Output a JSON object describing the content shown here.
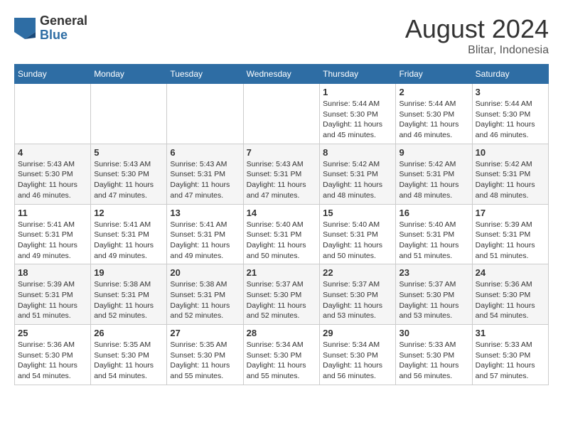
{
  "header": {
    "logo_general": "General",
    "logo_blue": "Blue",
    "title": "August 2024",
    "location": "Blitar, Indonesia"
  },
  "weekdays": [
    "Sunday",
    "Monday",
    "Tuesday",
    "Wednesday",
    "Thursday",
    "Friday",
    "Saturday"
  ],
  "weeks": [
    [
      {
        "day": "",
        "info": ""
      },
      {
        "day": "",
        "info": ""
      },
      {
        "day": "",
        "info": ""
      },
      {
        "day": "",
        "info": ""
      },
      {
        "day": "1",
        "info": "Sunrise: 5:44 AM\nSunset: 5:30 PM\nDaylight: 11 hours\nand 45 minutes."
      },
      {
        "day": "2",
        "info": "Sunrise: 5:44 AM\nSunset: 5:30 PM\nDaylight: 11 hours\nand 46 minutes."
      },
      {
        "day": "3",
        "info": "Sunrise: 5:44 AM\nSunset: 5:30 PM\nDaylight: 11 hours\nand 46 minutes."
      }
    ],
    [
      {
        "day": "4",
        "info": "Sunrise: 5:43 AM\nSunset: 5:30 PM\nDaylight: 11 hours\nand 46 minutes."
      },
      {
        "day": "5",
        "info": "Sunrise: 5:43 AM\nSunset: 5:30 PM\nDaylight: 11 hours\nand 47 minutes."
      },
      {
        "day": "6",
        "info": "Sunrise: 5:43 AM\nSunset: 5:31 PM\nDaylight: 11 hours\nand 47 minutes."
      },
      {
        "day": "7",
        "info": "Sunrise: 5:43 AM\nSunset: 5:31 PM\nDaylight: 11 hours\nand 47 minutes."
      },
      {
        "day": "8",
        "info": "Sunrise: 5:42 AM\nSunset: 5:31 PM\nDaylight: 11 hours\nand 48 minutes."
      },
      {
        "day": "9",
        "info": "Sunrise: 5:42 AM\nSunset: 5:31 PM\nDaylight: 11 hours\nand 48 minutes."
      },
      {
        "day": "10",
        "info": "Sunrise: 5:42 AM\nSunset: 5:31 PM\nDaylight: 11 hours\nand 48 minutes."
      }
    ],
    [
      {
        "day": "11",
        "info": "Sunrise: 5:41 AM\nSunset: 5:31 PM\nDaylight: 11 hours\nand 49 minutes."
      },
      {
        "day": "12",
        "info": "Sunrise: 5:41 AM\nSunset: 5:31 PM\nDaylight: 11 hours\nand 49 minutes."
      },
      {
        "day": "13",
        "info": "Sunrise: 5:41 AM\nSunset: 5:31 PM\nDaylight: 11 hours\nand 49 minutes."
      },
      {
        "day": "14",
        "info": "Sunrise: 5:40 AM\nSunset: 5:31 PM\nDaylight: 11 hours\nand 50 minutes."
      },
      {
        "day": "15",
        "info": "Sunrise: 5:40 AM\nSunset: 5:31 PM\nDaylight: 11 hours\nand 50 minutes."
      },
      {
        "day": "16",
        "info": "Sunrise: 5:40 AM\nSunset: 5:31 PM\nDaylight: 11 hours\nand 51 minutes."
      },
      {
        "day": "17",
        "info": "Sunrise: 5:39 AM\nSunset: 5:31 PM\nDaylight: 11 hours\nand 51 minutes."
      }
    ],
    [
      {
        "day": "18",
        "info": "Sunrise: 5:39 AM\nSunset: 5:31 PM\nDaylight: 11 hours\nand 51 minutes."
      },
      {
        "day": "19",
        "info": "Sunrise: 5:38 AM\nSunset: 5:31 PM\nDaylight: 11 hours\nand 52 minutes."
      },
      {
        "day": "20",
        "info": "Sunrise: 5:38 AM\nSunset: 5:31 PM\nDaylight: 11 hours\nand 52 minutes."
      },
      {
        "day": "21",
        "info": "Sunrise: 5:37 AM\nSunset: 5:30 PM\nDaylight: 11 hours\nand 52 minutes."
      },
      {
        "day": "22",
        "info": "Sunrise: 5:37 AM\nSunset: 5:30 PM\nDaylight: 11 hours\nand 53 minutes."
      },
      {
        "day": "23",
        "info": "Sunrise: 5:37 AM\nSunset: 5:30 PM\nDaylight: 11 hours\nand 53 minutes."
      },
      {
        "day": "24",
        "info": "Sunrise: 5:36 AM\nSunset: 5:30 PM\nDaylight: 11 hours\nand 54 minutes."
      }
    ],
    [
      {
        "day": "25",
        "info": "Sunrise: 5:36 AM\nSunset: 5:30 PM\nDaylight: 11 hours\nand 54 minutes."
      },
      {
        "day": "26",
        "info": "Sunrise: 5:35 AM\nSunset: 5:30 PM\nDaylight: 11 hours\nand 54 minutes."
      },
      {
        "day": "27",
        "info": "Sunrise: 5:35 AM\nSunset: 5:30 PM\nDaylight: 11 hours\nand 55 minutes."
      },
      {
        "day": "28",
        "info": "Sunrise: 5:34 AM\nSunset: 5:30 PM\nDaylight: 11 hours\nand 55 minutes."
      },
      {
        "day": "29",
        "info": "Sunrise: 5:34 AM\nSunset: 5:30 PM\nDaylight: 11 hours\nand 56 minutes."
      },
      {
        "day": "30",
        "info": "Sunrise: 5:33 AM\nSunset: 5:30 PM\nDaylight: 11 hours\nand 56 minutes."
      },
      {
        "day": "31",
        "info": "Sunrise: 5:33 AM\nSunset: 5:30 PM\nDaylight: 11 hours\nand 57 minutes."
      }
    ]
  ]
}
